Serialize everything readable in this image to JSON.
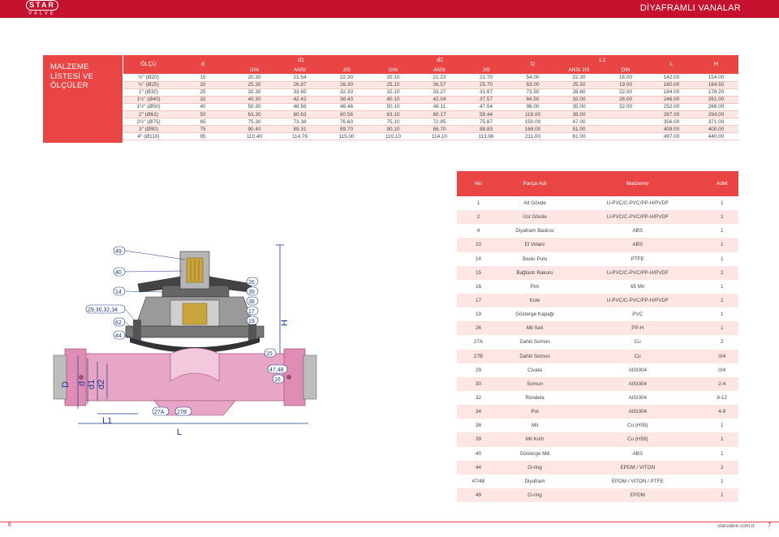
{
  "brand": {
    "logo_top": "STAR",
    "logo_bottom": "VALVE"
  },
  "header": {
    "title": "DİYAFRAMLI VANALAR"
  },
  "side_label": {
    "line1": "MALZEME",
    "line2": "LİSTESİ VE",
    "line3": "ÖLÇÜLER"
  },
  "dims": {
    "headers": {
      "olcu": "ÖLÇÜ",
      "d": "d",
      "d1": "d1",
      "d2": "d2",
      "D": "D",
      "L1": "L1",
      "L": "L",
      "H": "H",
      "d1_sub": [
        "DIN",
        "ANSI",
        "JIS"
      ],
      "d2_sub": [
        "DIN",
        "ANSI",
        "JIS"
      ],
      "l1_sub": [
        "ANSI JIS",
        "DIN"
      ]
    },
    "rows": [
      [
        "½\" (Ø20)",
        "15",
        "20.30",
        "21.54",
        "22.30",
        "20.10",
        "21.23",
        "21.70",
        "54.00",
        "22.30",
        "16.00",
        "142.00",
        "154.00"
      ],
      [
        "¾\" (Ø25)",
        "20",
        "25.30",
        "26.87",
        "26.30",
        "25.10",
        "26.57",
        "25.70",
        "63.00",
        "25.50",
        "19.00",
        "160.00",
        "164.50"
      ],
      [
        "1\" (Ø32)",
        "25",
        "32.30",
        "33.65",
        "32.33",
        "32.10",
        "33.27",
        "31.67",
        "73.50",
        "28.60",
        "22.00",
        "184.00",
        "178.20"
      ],
      [
        "1¼\" (Ø40)",
        "32",
        "40.30",
        "42.42",
        "38.43",
        "40.10",
        "42.04",
        "37.57",
        "84.50",
        "32.00",
        "26.00",
        "246.00",
        "261.00"
      ],
      [
        "1½\" (Ø50)",
        "40",
        "50.30",
        "48.56",
        "48.46",
        "50.10",
        "48.11",
        "47.54",
        "98.00",
        "35.00",
        "32.00",
        "252.00",
        "268.00"
      ],
      [
        "2\" (Ø63)",
        "50",
        "63.30",
        "60.63",
        "60.56",
        "63.10",
        "60.17",
        "59.44",
        "118.00",
        "38.00",
        "",
        "287.00",
        "294.00"
      ],
      [
        "2½\" (Ø75)",
        "65",
        "75.30",
        "73.38",
        "76.60",
        "75.10",
        "72.85",
        "75.87",
        "150.00",
        "47.00",
        "",
        "356.00",
        "371.00"
      ],
      [
        "3\" (Ø90)",
        "75",
        "90.40",
        "89.31",
        "89.70",
        "90.10",
        "88.70",
        "88.83",
        "169.00",
        "51.00",
        "",
        "409.00",
        "400.00"
      ],
      [
        "4\" (Ø110)",
        "95",
        "110.40",
        "114.76",
        "115.00",
        "110.10",
        "114.10",
        "113.98",
        "211.00",
        "61.00",
        "",
        "497.00",
        "440.00"
      ]
    ]
  },
  "parts": {
    "headers": {
      "no": "No",
      "name": "Parça Adı",
      "material": "Malzeme",
      "qty": "Adet"
    },
    "rows": [
      [
        "1",
        "Alt Gövde",
        "U-PVC/C-PVC/PP-H/PVDF",
        "1"
      ],
      [
        "2",
        "Üst Gövde",
        "U-PVC/C-PVC/PP-H/PVDF",
        "1"
      ],
      [
        "4",
        "Diyafram Baskısı",
        "ABS",
        "1"
      ],
      [
        "10",
        "El Volanı",
        "ABS",
        "1"
      ],
      [
        "14",
        "Baskı Pulu",
        "PTFE",
        "1"
      ],
      [
        "15",
        "Bağlantı Rakoru",
        "U-PVC/C-PVC/PP-H/PVDF",
        "2"
      ],
      [
        "16",
        "Pim",
        "65 Mn",
        "1"
      ],
      [
        "17",
        "Kole",
        "U-PVC/C-PVC/PP-H/PVDF",
        "2"
      ],
      [
        "19",
        "Gösterge Kapağı",
        "PVC",
        "1"
      ],
      [
        "26",
        "Mil Seti",
        "PP-H",
        "1"
      ],
      [
        "27A",
        "Dahili Somun",
        "Cu",
        "2"
      ],
      [
        "27B",
        "Dahili Somun",
        "Cu",
        "0/4"
      ],
      [
        "29",
        "Civata",
        "AISI304",
        "0/4"
      ],
      [
        "30",
        "Somun",
        "AISI304",
        "2-4"
      ],
      [
        "32",
        "Rondela",
        "AISI304",
        "8-12"
      ],
      [
        "34",
        "Pul",
        "AISI304",
        "4-8"
      ],
      [
        "38",
        "Mil",
        "Cu (H59)",
        "1"
      ],
      [
        "39",
        "Mil Kılıfı",
        "Cu (H59)",
        "1"
      ],
      [
        "40",
        "Gösterge Mili",
        "ABS",
        "1"
      ],
      [
        "44",
        "O-ring",
        "EPDM / VITON",
        "2"
      ],
      [
        "47/48",
        "Diyafram",
        "EPDM / VITON / PTFE",
        "1"
      ],
      [
        "49",
        "O-ring",
        "EPDM",
        "1"
      ]
    ]
  },
  "drawing": {
    "callouts_left": [
      "49",
      "40",
      "14",
      "29,30,32,34",
      "62",
      "44"
    ],
    "callouts_right": [
      "26",
      "39",
      "38",
      "17",
      "19",
      "15",
      "47,48",
      "16"
    ],
    "callouts_bottom": [
      "27A",
      "27B"
    ],
    "dim_labels": [
      "D",
      "d",
      "d1",
      "d2",
      "L",
      "L1",
      "H"
    ]
  },
  "footer": {
    "page_left": "6",
    "site": "starvalve.com.tr",
    "page_right": "7"
  },
  "colors": {
    "brand_red": "#c4122f",
    "header_red": "#e94545",
    "row_pink": "#fde6e4",
    "pipe_pink": "#e8a6c6"
  }
}
